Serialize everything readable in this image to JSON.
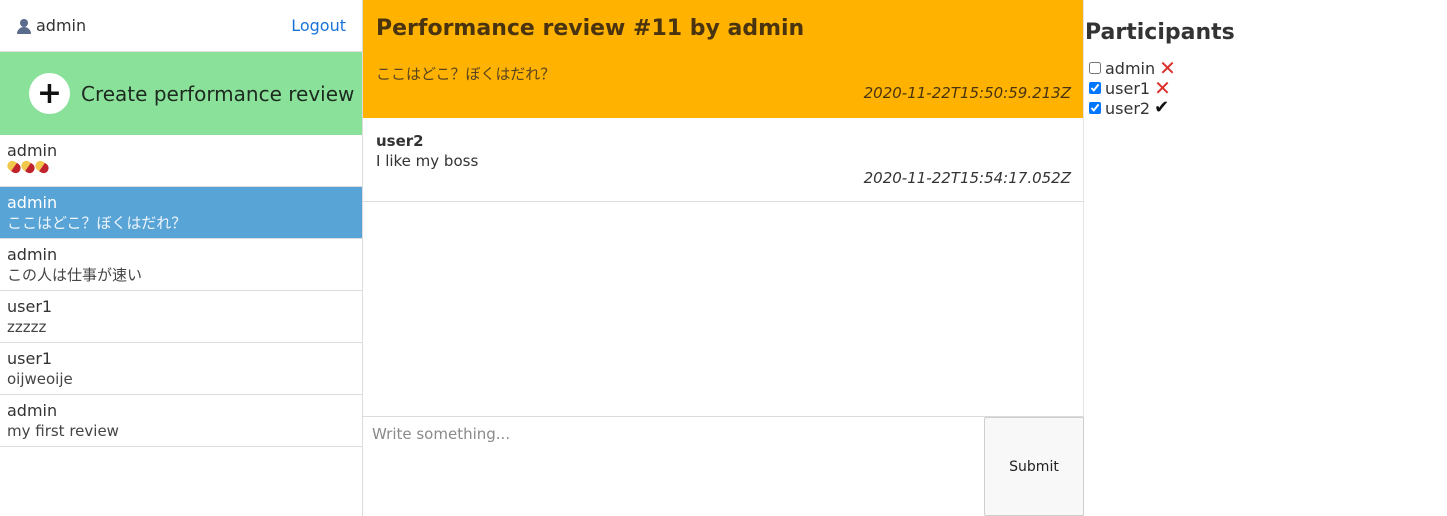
{
  "sidebar": {
    "username": "admin",
    "logout_label": "Logout",
    "create_label": "Create performance review",
    "reviews": [
      {
        "author": "admin",
        "excerpt": "",
        "has_pills": true
      },
      {
        "author": "admin",
        "excerpt": "ここはどこ？ぼくはだれ？",
        "active": true
      },
      {
        "author": "admin",
        "excerpt": "この人は仕事が速い"
      },
      {
        "author": "user1",
        "excerpt": "zzzzz"
      },
      {
        "author": "user1",
        "excerpt": "oijweoije"
      },
      {
        "author": "admin",
        "excerpt": "my first review"
      }
    ]
  },
  "review": {
    "title": "Performance review #11 by admin",
    "text": "ここはどこ？ぼくはだれ？",
    "timestamp": "2020-11-22T15:50:59.213Z"
  },
  "comments": [
    {
      "author": "user2",
      "text": "I like my boss",
      "timestamp": "2020-11-22T15:54:17.052Z"
    }
  ],
  "composer": {
    "placeholder": "Write something...",
    "submit_label": "Submit"
  },
  "participants": {
    "heading": "Participants",
    "items": [
      {
        "name": "admin",
        "checked": false,
        "status": "x"
      },
      {
        "name": "user1",
        "checked": true,
        "status": "x"
      },
      {
        "name": "user2",
        "checked": true,
        "status": "check"
      }
    ]
  },
  "colors": {
    "create_bg": "#8ae29a",
    "active_item_bg": "#58a4d6",
    "review_header_bg": "#ffb300",
    "link": "#1a73d9",
    "reject": "#d9302c"
  }
}
